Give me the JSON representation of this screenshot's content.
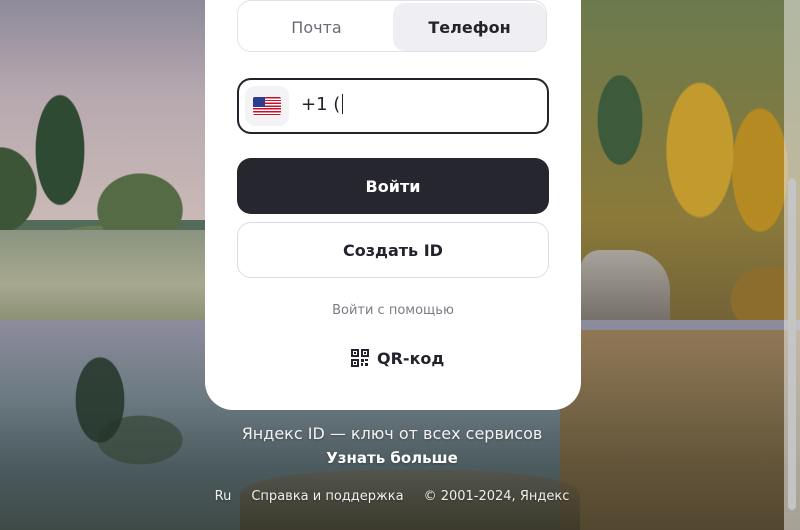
{
  "login_card": {
    "tabs": [
      {
        "label": "Почта",
        "active": false
      },
      {
        "label": "Телефон",
        "active": true
      }
    ],
    "phone_input": {
      "country_flag": "us-flag-icon",
      "value": "+1 ("
    },
    "login_button": "Войти",
    "create_id_button": "Создать ID",
    "login_with_text": "Войти с помощью",
    "qr_button": {
      "icon": "qr-code-icon",
      "label": "QR-код"
    }
  },
  "tagline": "Яндекс ID — ключ от всех сервисов",
  "learn_more": "Узнать больше",
  "footer": {
    "language": "Ru",
    "help": "Справка и поддержка",
    "copyright": "© 2001-2024, Яндекс"
  },
  "colors": {
    "primary_button": "#26262e",
    "active_tab_bg": "#eeeef3",
    "card_bg": "#ffffff"
  }
}
